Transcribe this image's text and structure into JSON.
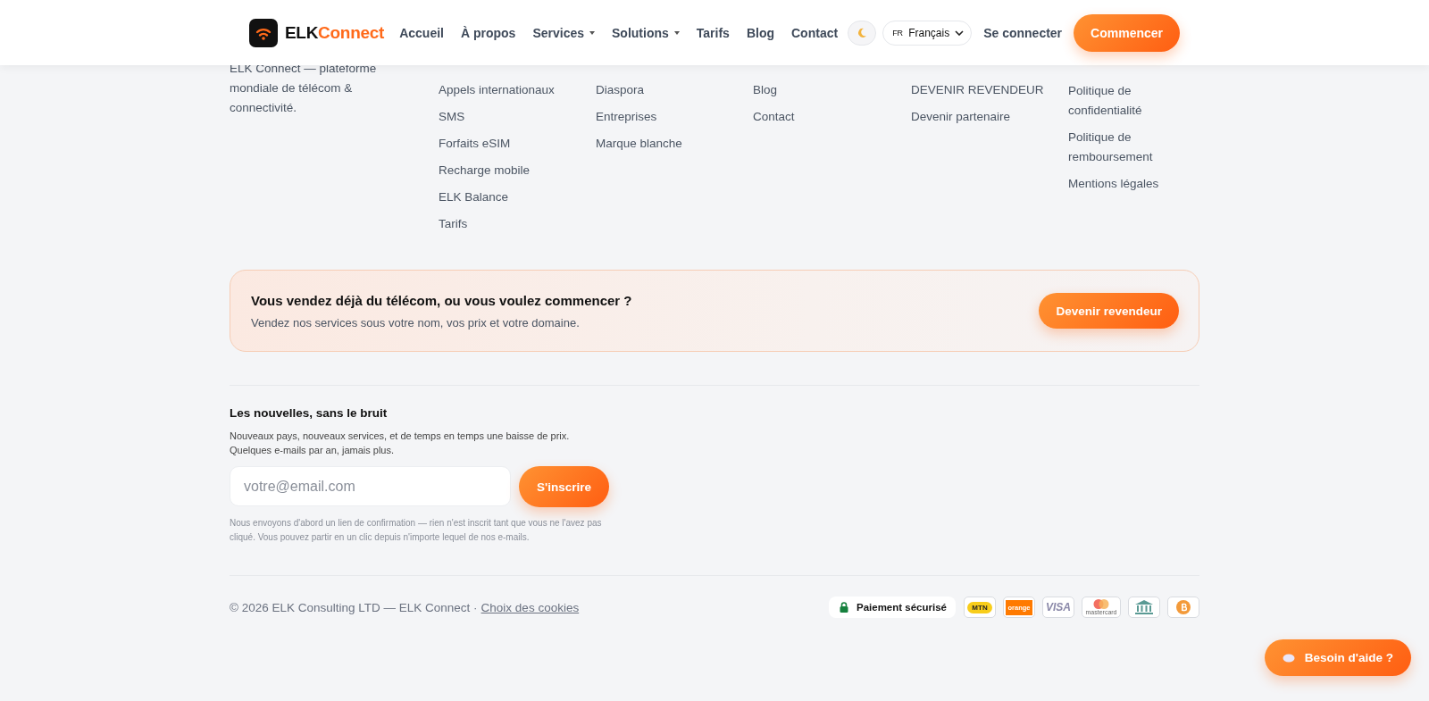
{
  "header": {
    "logo": {
      "prefix": "ELK",
      "suffix": "Connect"
    },
    "nav": [
      {
        "label": "Accueil",
        "dropdown": false
      },
      {
        "label": "À propos",
        "dropdown": false
      },
      {
        "label": "Services",
        "dropdown": true
      },
      {
        "label": "Solutions",
        "dropdown": true
      },
      {
        "label": "Tarifs",
        "dropdown": false
      },
      {
        "label": "Blog",
        "dropdown": false
      },
      {
        "label": "Contact",
        "dropdown": false
      }
    ],
    "language": {
      "code": "FR",
      "label": "Français"
    },
    "login": "Se connecter",
    "cta": "Commencer"
  },
  "footer": {
    "description": "ELK Connect — plateforme mondiale de télécom & connectivité.",
    "columns": [
      [
        "Appels internationaux",
        "SMS",
        "Forfaits eSIM",
        "Recharge mobile",
        "ELK Balance",
        "Tarifs"
      ],
      [
        "Diaspora",
        "Entreprises",
        "Marque blanche"
      ],
      [
        "Blog",
        "Contact"
      ],
      [
        "DEVENIR REVENDEUR",
        "Devenir partenaire"
      ],
      [
        "Politique de confidentialité",
        "Politique de remboursement",
        "Mentions légales"
      ]
    ],
    "banner": {
      "title": "Vous vendez déjà du télécom, ou vous voulez commencer ?",
      "text": "Vendez nos services sous votre nom, vos prix et votre domaine.",
      "button": "Devenir revendeur"
    },
    "newsletter": {
      "title": "Les nouvelles, sans le bruit",
      "text": "Nouveaux pays, nouveaux services, et de temps en temps une baisse de prix. Quelques e-mails par an, jamais plus.",
      "placeholder": "votre@email.com",
      "button": "S'inscrire",
      "note": "Nous envoyons d'abord un lien de confirmation — rien n'est inscrit tant que vous ne l'avez pas cliqué. Vous pouvez partir en un clic depuis n'importe lequel de nos e-mails."
    },
    "bottom": {
      "copyright": "© 2026 ELK Consulting LTD — ELK Connect ·",
      "cookies": "Choix des cookies",
      "secure": "Paiement sécurisé",
      "payments": [
        {
          "kind": "mtn",
          "label": "MTN"
        },
        {
          "kind": "orange",
          "label": "orange"
        },
        {
          "kind": "visa",
          "label": "VISA"
        },
        {
          "kind": "mastercard",
          "label": "mastercard"
        },
        {
          "kind": "bank"
        },
        {
          "kind": "bitcoin"
        }
      ]
    }
  },
  "help": {
    "label": "Besoin d'aide ?"
  }
}
